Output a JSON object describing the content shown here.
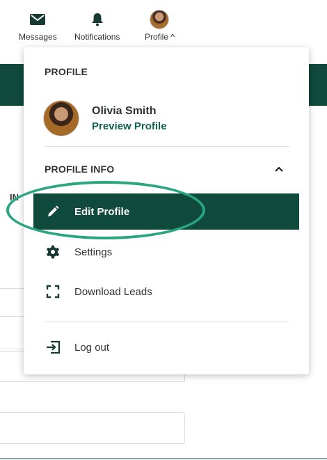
{
  "topnav": {
    "messages_label": "Messages",
    "notifications_label": "Notifications",
    "profile_label": "Profile ^"
  },
  "background": {
    "partial_label": "IN"
  },
  "dropdown": {
    "profile_heading": "PROFILE",
    "user": {
      "name": "Olivia Smith",
      "preview_link": "Preview Profile"
    },
    "profile_info_heading": "PROFILE INFO",
    "menu": [
      {
        "label": "Edit Profile",
        "icon": "pencil-icon",
        "active": true
      },
      {
        "label": "Settings",
        "icon": "gear-icon",
        "active": false
      },
      {
        "label": "Download Leads",
        "icon": "expand-frame-icon",
        "active": false
      }
    ],
    "logout_label": "Log out"
  },
  "colors": {
    "brand_dark_green": "#0f4a3d",
    "link_green": "#15604e",
    "highlight_ring": "#2aa580"
  }
}
